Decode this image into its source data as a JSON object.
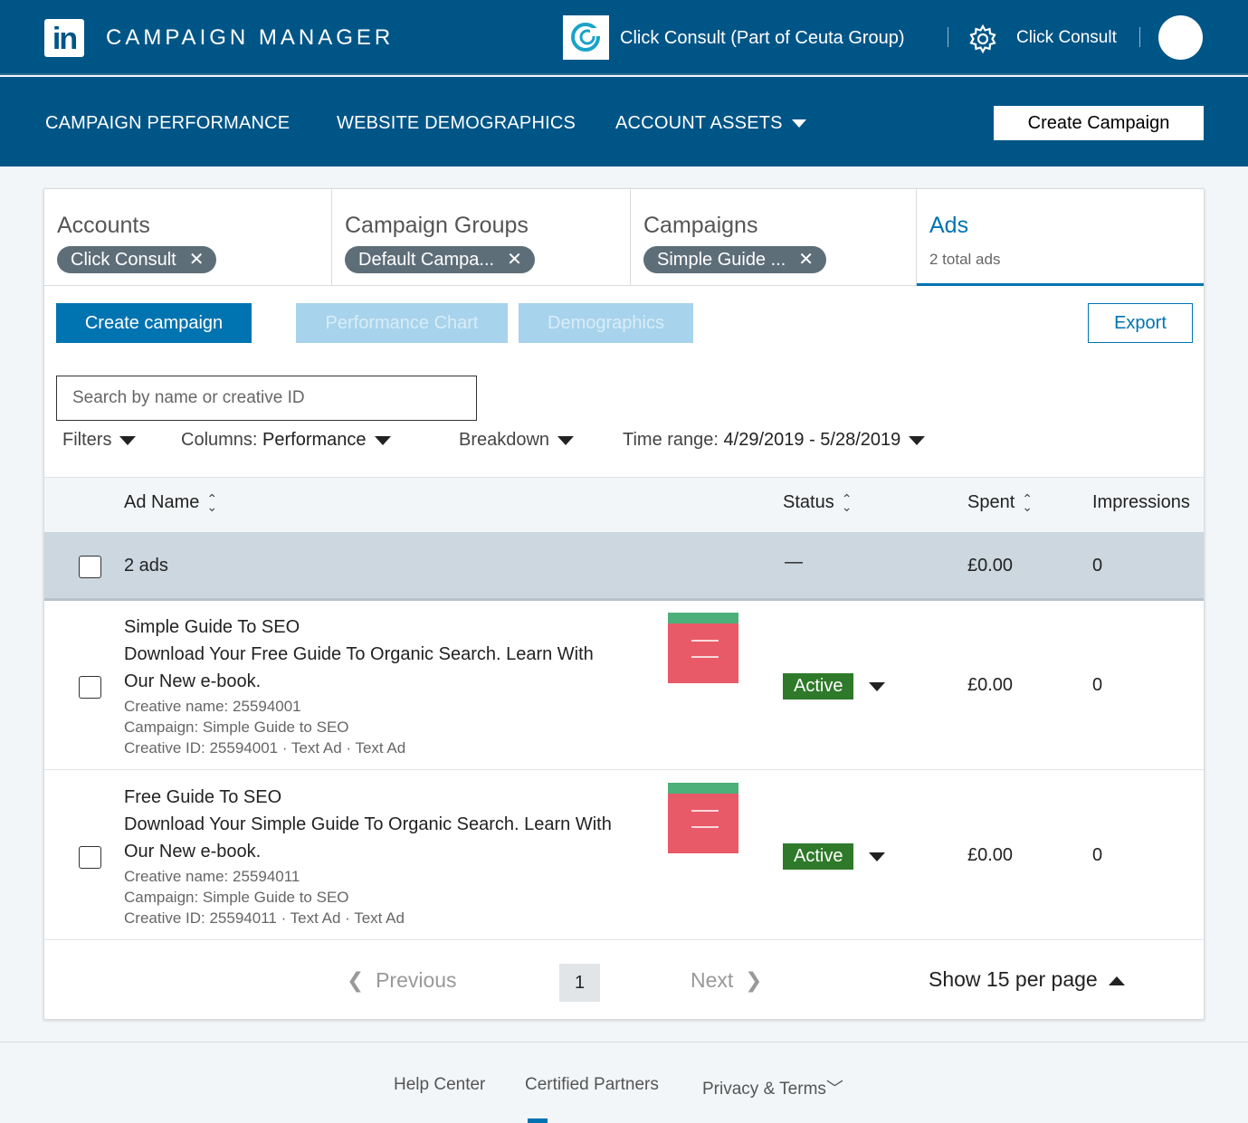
{
  "header": {
    "app_title": "CAMPAIGN MANAGER",
    "account_name": "Click Consult (Part of Ceuta Group)",
    "user_name": "Click Consult"
  },
  "nav": {
    "items": [
      {
        "label": "CAMPAIGN PERFORMANCE"
      },
      {
        "label": "WEBSITE DEMOGRAPHICS"
      },
      {
        "label": "ACCOUNT ASSETS"
      }
    ],
    "create_campaign": "Create Campaign"
  },
  "breadcrumbs": [
    {
      "title": "Accounts",
      "chip": "Click Consult"
    },
    {
      "title": "Campaign Groups",
      "chip": "Default Campa..."
    },
    {
      "title": "Campaigns",
      "chip": "Simple Guide ..."
    },
    {
      "title": "Ads",
      "sub": "2 total ads"
    }
  ],
  "toolbar": {
    "create_campaign": "Create campaign",
    "performance_chart": "Performance Chart",
    "demographics": "Demographics",
    "export": "Export"
  },
  "search": {
    "placeholder": "Search by name or creative ID"
  },
  "filters": {
    "filters_label": "Filters",
    "columns_label": "Columns:",
    "columns_value": "Performance",
    "breakdown_label": "Breakdown",
    "time_label": "Time range:",
    "time_value": "4/29/2019 - 5/28/2019"
  },
  "table": {
    "headers": {
      "ad_name": "Ad Name",
      "status": "Status",
      "spent": "Spent",
      "impressions": "Impressions"
    },
    "summary": {
      "label": "2 ads",
      "status": "—",
      "spent": "£0.00",
      "impressions": "0"
    },
    "rows": [
      {
        "title": "Simple Guide To SEO",
        "desc1": "Download Your Free Guide To Organic Search. Learn With",
        "desc2": "Our New e-book.",
        "creative_name": "Creative name: 25594001",
        "campaign": "Campaign: Simple Guide to SEO",
        "creative_id": "Creative ID: 25594001 · Text Ad · Text Ad",
        "status": "Active",
        "spent": "£0.00",
        "impressions": "0"
      },
      {
        "title": "Free Guide To SEO",
        "desc1": "Download Your Simple Guide To Organic Search. Learn With",
        "desc2": "Our New e-book.",
        "creative_name": "Creative name: 25594011",
        "campaign": "Campaign: Simple Guide to SEO",
        "creative_id": "Creative ID: 25594011 · Text Ad · Text Ad",
        "status": "Active",
        "spent": "£0.00",
        "impressions": "0"
      }
    ]
  },
  "pager": {
    "previous": "Previous",
    "page": "1",
    "next": "Next",
    "per_page": "Show 15 per page"
  },
  "footer": {
    "help": "Help Center",
    "partners": "Certified Partners",
    "privacy": "Privacy & Terms"
  },
  "colors": {
    "brand": "#005587",
    "primary": "#0073b1",
    "active": "#2f7a2a"
  }
}
